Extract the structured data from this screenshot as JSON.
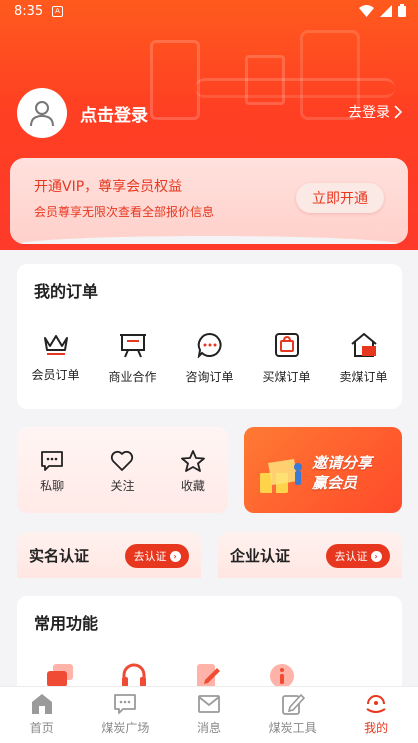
{
  "status": {
    "time": "8:35",
    "notification_icon": "A"
  },
  "header": {
    "title": "点击登录",
    "login_link": "去登录"
  },
  "vip": {
    "title": "开通VIP，尊享会员权益",
    "subtitle": "会员尊享无限次查看全部报价信息",
    "button": "立即开通"
  },
  "orders": {
    "title": "我的订单",
    "items": [
      {
        "label": "会员订单",
        "icon": "crown-icon"
      },
      {
        "label": "商业合作",
        "icon": "presentation-board-icon"
      },
      {
        "label": "咨询订单",
        "icon": "chat-bubble-icon"
      },
      {
        "label": "买煤订单",
        "icon": "shopping-bag-icon"
      },
      {
        "label": "卖煤订单",
        "icon": "store-icon"
      }
    ]
  },
  "social": {
    "items": [
      {
        "label": "私聊",
        "icon": "message-icon"
      },
      {
        "label": "关注",
        "icon": "heart-icon"
      },
      {
        "label": "收藏",
        "icon": "star-icon"
      }
    ]
  },
  "invite": {
    "line1": "邀请分享",
    "line2": "赢会员"
  },
  "certifications": [
    {
      "name": "实名认证",
      "button": "去认证"
    },
    {
      "name": "企业认证",
      "button": "去认证"
    }
  ],
  "common": {
    "title": "常用功能"
  },
  "tabbar": {
    "items": [
      {
        "label": "首页",
        "icon": "home-icon",
        "active": false
      },
      {
        "label": "煤炭广场",
        "icon": "square-chat-icon",
        "active": false
      },
      {
        "label": "消息",
        "icon": "mail-icon",
        "active": false
      },
      {
        "label": "煤炭工具",
        "icon": "edit-icon",
        "active": false
      },
      {
        "label": "我的",
        "icon": "profile-icon",
        "active": true
      }
    ]
  },
  "colors": {
    "brand": "#e8371f",
    "header": "#ff4a23"
  }
}
